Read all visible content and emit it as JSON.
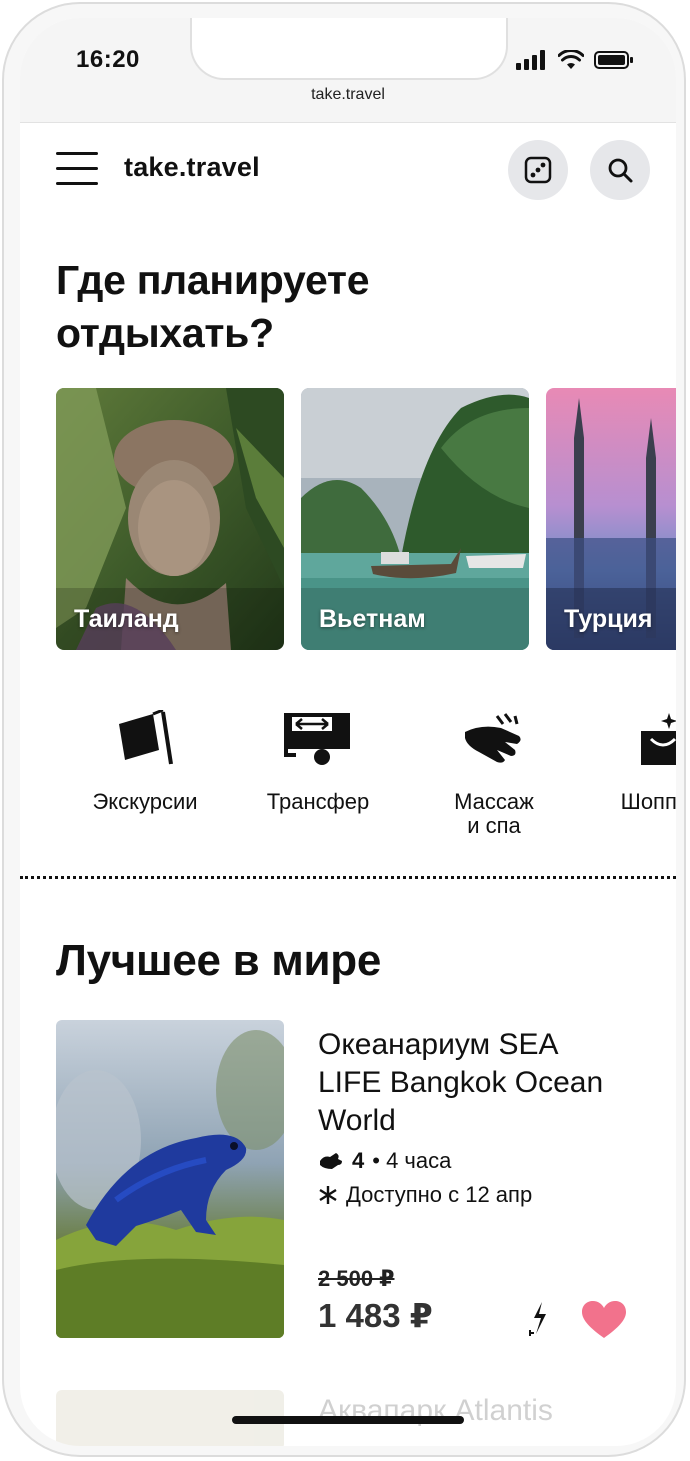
{
  "status": {
    "time": "16:20",
    "url": "take.travel"
  },
  "header": {
    "brand": "take.travel"
  },
  "hero": {
    "question": "Где планируете отдыхать?"
  },
  "destinations": [
    {
      "label": "Таиланд"
    },
    {
      "label": "Вьетнам"
    },
    {
      "label": "Турция"
    }
  ],
  "categories": [
    {
      "label": "Экскурсии",
      "icon": "flag-icon"
    },
    {
      "label": "Трансфер",
      "icon": "transfer-bus-icon"
    },
    {
      "label": "Массаж\nи спа",
      "icon": "massage-hand-icon"
    },
    {
      "label": "Шоппинг",
      "icon": "shopping-bag-icon"
    }
  ],
  "best": {
    "heading": "Лучшее в мире",
    "items": [
      {
        "title": "Океанариум SEA LIFE Bangkok Ocean World",
        "rating": "4",
        "duration": "• 4 часа",
        "availability": "Доступно с 12 апр",
        "old_price": "2 500 ₽",
        "price": "1 483 ₽",
        "favorite": true
      },
      {
        "title": "Аквапарк Atlantis"
      }
    ]
  },
  "colors": {
    "accent_heart": "#f2728c",
    "button_bg": "#e6e7ea"
  }
}
